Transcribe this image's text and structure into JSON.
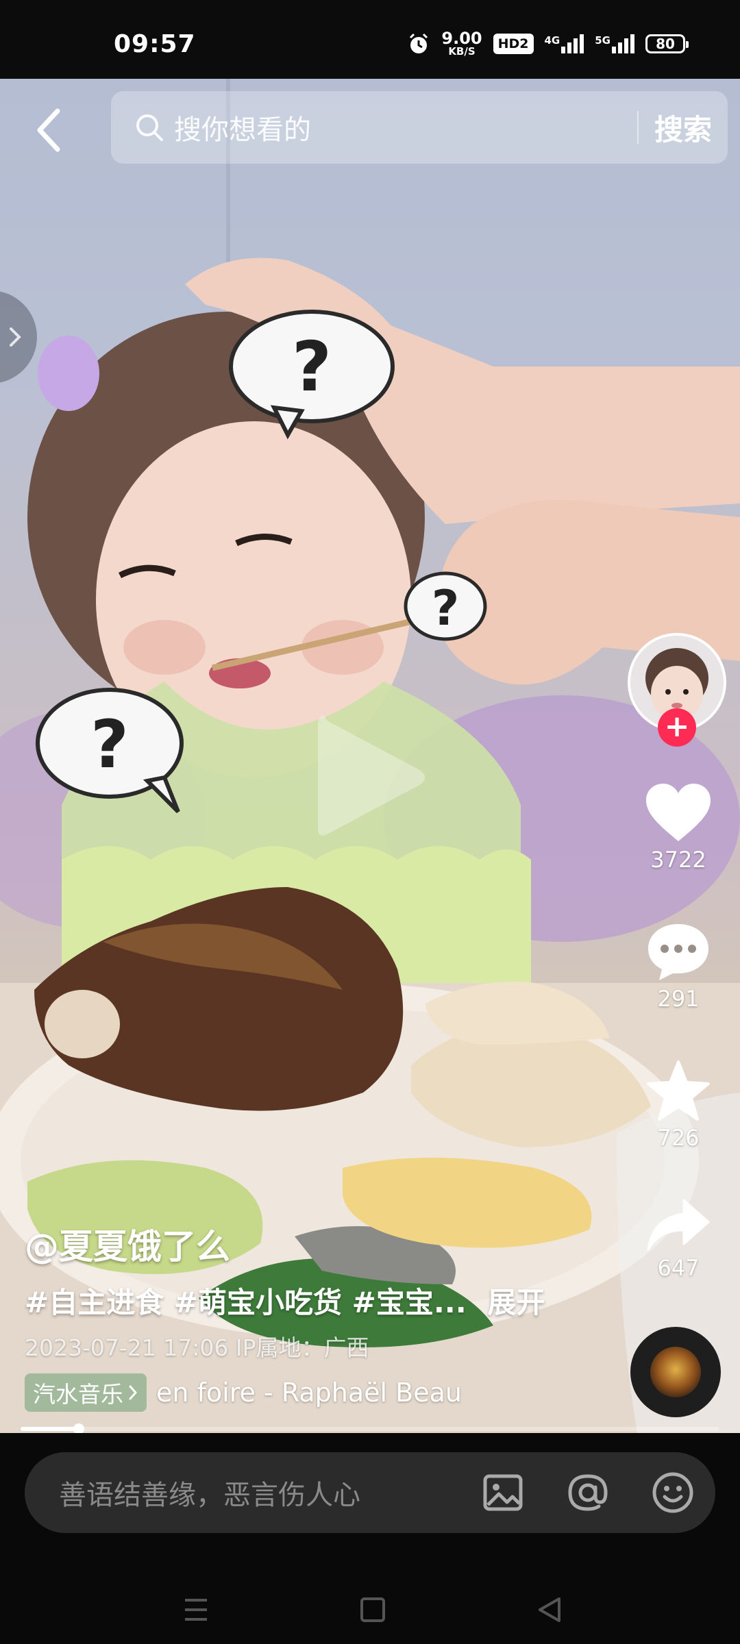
{
  "status_bar": {
    "time": "09:57",
    "net_speed_value": "9.00",
    "net_speed_unit": "KB/S",
    "hd_badge": "HD2",
    "network_1": "4G",
    "network_2": "5G",
    "battery": "80"
  },
  "search": {
    "placeholder": "搜你想看的",
    "button_label": "搜索"
  },
  "video": {
    "overlay_marks": [
      "?",
      "?",
      "?"
    ]
  },
  "rail": {
    "likes": "3722",
    "comments": "291",
    "favorites": "726",
    "shares": "647",
    "follow_symbol": "+"
  },
  "caption": {
    "author": "@夏夏饿了么",
    "hashtags": "#自主进食 #萌宝小吃货 #宝宝...",
    "expand_label": "展开",
    "meta": "2023-07-21 17:06  IP属地：广西",
    "music_chip": "汽水音乐",
    "music_title": "en foire - Raphaël Beau"
  },
  "progress": {
    "played_fraction": 0.083
  },
  "comment_bar": {
    "placeholder": "善语结善缘，恶言伤人心"
  },
  "colors": {
    "accent": "#fe2c55",
    "music_chip": "#8caf8c"
  },
  "icons": [
    "back-icon",
    "search-icon",
    "play-icon",
    "heart-icon",
    "comment-icon",
    "star-icon",
    "share-icon",
    "image-icon",
    "at-icon",
    "emoji-icon",
    "menu-icon",
    "home-icon",
    "back-nav-icon"
  ]
}
